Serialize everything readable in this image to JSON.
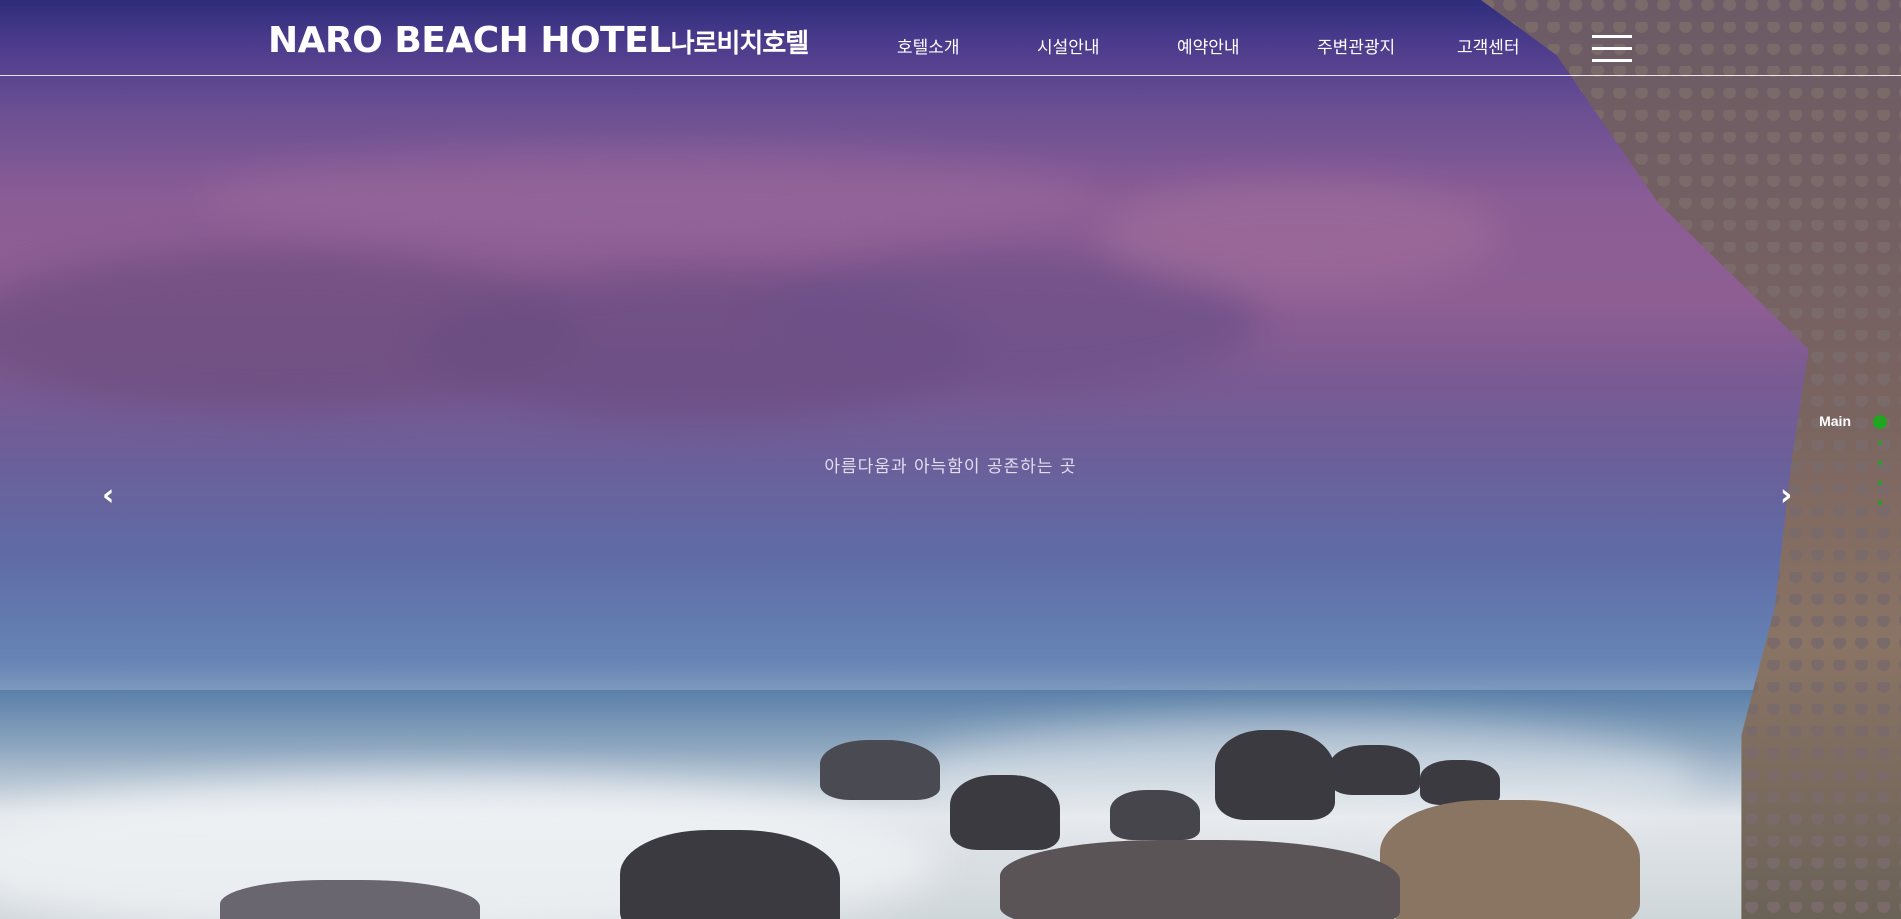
{
  "header": {
    "logo_en": "NARO BEACH HOTEL",
    "logo_ko": "나로비치호텔",
    "nav": [
      "호텔소개",
      "시설안내",
      "예약안내",
      "주변관광지",
      "고객센터"
    ]
  },
  "hero": {
    "slogan": "아름다움과 아늑함이 공존하는 곳",
    "prev_arrow": "‹",
    "next_arrow": "›"
  },
  "pager": {
    "label": "Main",
    "active_color": "#1fa51f"
  },
  "icons": {
    "menu": "hamburger-menu-icon"
  }
}
